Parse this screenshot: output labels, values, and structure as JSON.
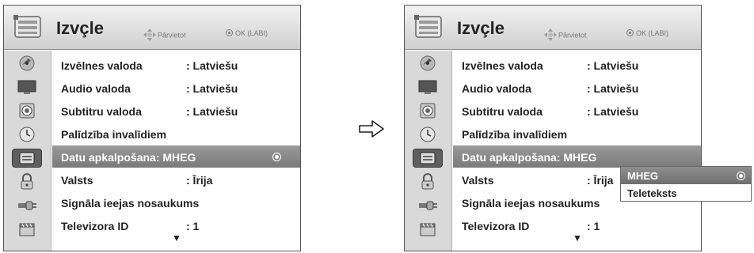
{
  "menu": {
    "title": "Izvçle",
    "hint_move": "Pārvietot",
    "hint_ok": "OK (LABI)",
    "items": [
      {
        "label": "Izvēlnes valoda",
        "value": ": Latviešu"
      },
      {
        "label": "Audio valoda",
        "value": ": Latviešu"
      },
      {
        "label": "Subtitru valoda",
        "value": ": Latviešu"
      },
      {
        "label": "Palīdzība invalīdiem",
        "value": ""
      },
      {
        "label": "Datu apkalpošana: MHEG",
        "value": ""
      },
      {
        "label": "Valsts",
        "value": ": Īrija"
      },
      {
        "label": "Signāla ieejas nosaukums",
        "value": ""
      },
      {
        "label": "Televizora ID",
        "value": ": 1"
      }
    ],
    "more_indicator": "▼"
  },
  "popup": {
    "options": [
      "MHEG",
      "Teleteksts"
    ],
    "selected": "MHEG"
  },
  "side_icons": [
    "satellite-icon",
    "monitor-icon",
    "speaker-icon",
    "clock-icon",
    "options-icon",
    "lock-icon",
    "input-plug-icon",
    "media-clapper-icon"
  ],
  "colors": {
    "selected_row": "#8a8a8a",
    "header": "#dcdcdc",
    "sidebar": "#d9d9d9"
  }
}
